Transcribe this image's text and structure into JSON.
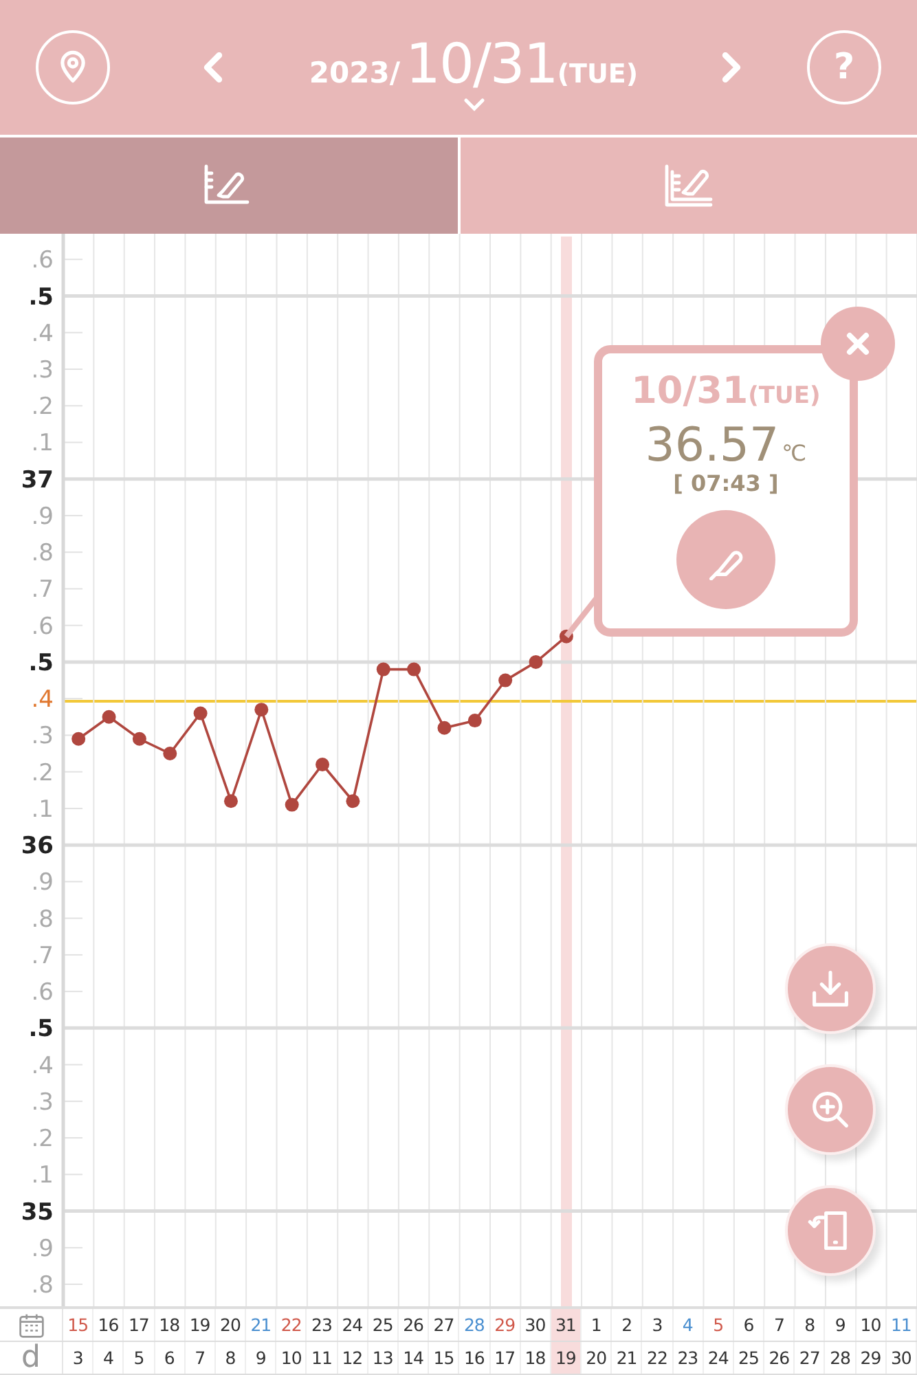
{
  "header": {
    "year": "2023/",
    "date": "10/31",
    "weekday": "(TUE)",
    "help_label": "?"
  },
  "tabs": [
    {
      "kind": "single",
      "selected": true
    },
    {
      "kind": "compare",
      "selected": false
    }
  ],
  "chart": {
    "chart_data": {
      "type": "line",
      "categories": [
        "15",
        "16",
        "17",
        "18",
        "19",
        "20",
        "21",
        "22",
        "23",
        "24",
        "25",
        "26",
        "27",
        "28",
        "29",
        "30",
        "31",
        "1",
        "2",
        "3",
        "4",
        "5",
        "6",
        "7",
        "8",
        "9",
        "10",
        "11"
      ],
      "grid": true,
      "series": [
        {
          "color": "#b0473f",
          "marker": "circle",
          "values": [
            36.29,
            36.35,
            36.29,
            36.25,
            36.36,
            36.12,
            36.37,
            36.11,
            36.22,
            36.12,
            36.48,
            36.48,
            36.32,
            36.34,
            36.45,
            36.5,
            36.57,
            null,
            null,
            null,
            null,
            null,
            null,
            null,
            null,
            null,
            null,
            null
          ]
        }
      ],
      "ylim": [
        34.74,
        37.67
      ],
      "yticks": [
        37,
        36,
        35
      ]
    },
    "y_fraction_labels": [
      {
        "text": ".6",
        "coverline": false
      },
      {
        "text": ".5",
        "coverline": false
      },
      {
        "text": ".4",
        "coverline": false
      },
      {
        "text": ".3",
        "coverline": false
      },
      {
        "text": ".2",
        "coverline": false
      },
      {
        "text": ".1",
        "coverline": false
      },
      {
        "text": ".9",
        "coverline": false
      },
      {
        "text": ".8",
        "coverline": false
      },
      {
        "text": ".7",
        "coverline": false
      },
      {
        "text": ".6",
        "coverline": false
      },
      {
        "text": ".5",
        "coverline": false
      },
      {
        "text": ".4",
        "coverline": true
      },
      {
        "text": ".3",
        "coverline": false
      },
      {
        "text": ".2",
        "coverline": false
      },
      {
        "text": ".1",
        "coverline": false
      },
      {
        "text": ".9",
        "coverline": false
      },
      {
        "text": ".8",
        "coverline": false
      },
      {
        "text": ".7",
        "coverline": false
      },
      {
        "text": ".6",
        "coverline": false
      },
      {
        "text": ".5",
        "coverline": false
      },
      {
        "text": ".4",
        "coverline": false
      },
      {
        "text": ".3",
        "coverline": false
      },
      {
        "text": ".2",
        "coverline": false
      },
      {
        "text": ".1",
        "coverline": false
      },
      {
        "text": ".9",
        "coverline": false
      },
      {
        "text": ".8",
        "coverline": false
      }
    ],
    "popup": {
      "date": "10/31",
      "weekday": "(TUE)",
      "temperature": "36.57",
      "unit": "℃",
      "time": "[ 07:43 ]"
    }
  },
  "fabs": [
    {
      "kind": "download"
    },
    {
      "kind": "zoom"
    },
    {
      "kind": "rotate"
    }
  ],
  "footer": {
    "cycle_label": "d",
    "columns": [
      {
        "cycle_day": "3",
        "color": "#d0584a",
        "selected": false
      },
      {
        "cycle_day": "4",
        "color": "#333333",
        "selected": false
      },
      {
        "cycle_day": "5",
        "color": "#333333",
        "selected": false
      },
      {
        "cycle_day": "6",
        "color": "#333333",
        "selected": false
      },
      {
        "cycle_day": "7",
        "color": "#333333",
        "selected": false
      },
      {
        "cycle_day": "8",
        "color": "#333333",
        "selected": false
      },
      {
        "cycle_day": "9",
        "color": "#4a8fd0",
        "selected": false
      },
      {
        "cycle_day": "10",
        "color": "#d0584a",
        "selected": false
      },
      {
        "cycle_day": "11",
        "color": "#333333",
        "selected": false
      },
      {
        "cycle_day": "12",
        "color": "#333333",
        "selected": false
      },
      {
        "cycle_day": "13",
        "color": "#333333",
        "selected": false
      },
      {
        "cycle_day": "14",
        "color": "#333333",
        "selected": false
      },
      {
        "cycle_day": "15",
        "color": "#333333",
        "selected": false
      },
      {
        "cycle_day": "16",
        "color": "#4a8fd0",
        "selected": false
      },
      {
        "cycle_day": "17",
        "color": "#d0584a",
        "selected": false
      },
      {
        "cycle_day": "18",
        "color": "#333333",
        "selected": false
      },
      {
        "cycle_day": "19",
        "color": "#333333",
        "selected": true
      },
      {
        "cycle_day": "20",
        "color": "#333333",
        "selected": false
      },
      {
        "cycle_day": "21",
        "color": "#333333",
        "selected": false
      },
      {
        "cycle_day": "22",
        "color": "#333333",
        "selected": false
      },
      {
        "cycle_day": "23",
        "color": "#4a8fd0",
        "selected": false
      },
      {
        "cycle_day": "24",
        "color": "#d0584a",
        "selected": false
      },
      {
        "cycle_day": "25",
        "color": "#333333",
        "selected": false
      },
      {
        "cycle_day": "26",
        "color": "#333333",
        "selected": false
      },
      {
        "cycle_day": "27",
        "color": "#333333",
        "selected": false
      },
      {
        "cycle_day": "28",
        "color": "#333333",
        "selected": false
      },
      {
        "cycle_day": "29",
        "color": "#333333",
        "selected": false
      },
      {
        "cycle_day": "30",
        "color": "#4a8fd0",
        "selected": false
      }
    ]
  }
}
